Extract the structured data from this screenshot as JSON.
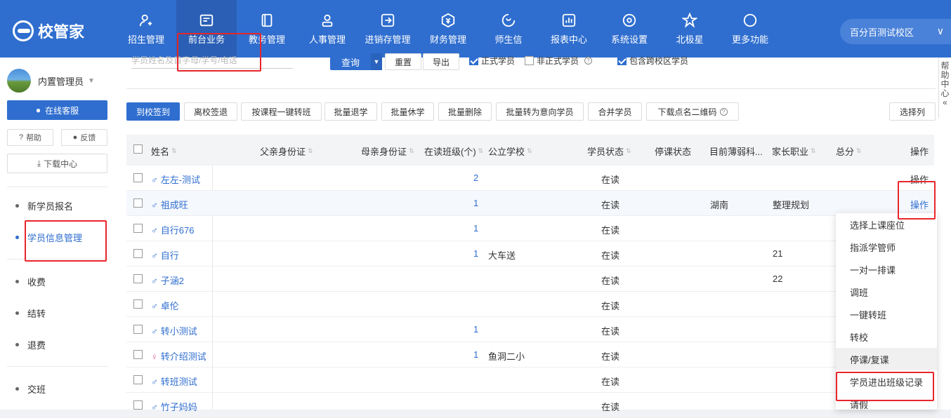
{
  "brand": {
    "name": "校管家"
  },
  "nav": [
    {
      "label": "招生管理",
      "icon": "user-plus-icon"
    },
    {
      "label": "前台业务",
      "icon": "reception-icon"
    },
    {
      "label": "教务管理",
      "icon": "book-icon"
    },
    {
      "label": "人事管理",
      "icon": "person-icon"
    },
    {
      "label": "进销存管理",
      "icon": "inventory-icon"
    },
    {
      "label": "财务管理",
      "icon": "finance-icon"
    },
    {
      "label": "师生信",
      "icon": "message-icon"
    },
    {
      "label": "报表中心",
      "icon": "chart-icon"
    },
    {
      "label": "系统设置",
      "icon": "settings-icon"
    },
    {
      "label": "北极星",
      "icon": "star-icon"
    },
    {
      "label": "更多功能",
      "icon": "more-icon"
    }
  ],
  "campus": "百分百测试校区",
  "sidebar": {
    "user": "内置管理员",
    "service": "在线客服",
    "help": "帮助",
    "feedback": "反馈",
    "download": "下载中心",
    "items": [
      "新学员报名",
      "学员信息管理",
      "收费",
      "结转",
      "退费",
      "交班"
    ]
  },
  "search": {
    "placeholder": "学员姓名及首字母/学号/电话",
    "query": "查询",
    "reset": "重置",
    "export": "导出",
    "formal": "正式学员",
    "informal": "非正式学员",
    "cross": "包含跨校区学员"
  },
  "toolbar": [
    "到校签到",
    "离校签退",
    "按课程一键转班",
    "批量退学",
    "批量休学",
    "批量删除",
    "批量转为意向学员",
    "合并学员",
    "下载点名二维码"
  ],
  "select_col": "选择列",
  "columns": [
    "姓名",
    "父亲身份证",
    "母亲身份证",
    "在读班级(个)",
    "公立学校",
    "学员状态",
    "停课状态",
    "目前薄弱科...",
    "家长职业",
    "总分",
    "操作"
  ],
  "rows": [
    {
      "name": "左左-测试",
      "gender": "male",
      "classes": "2",
      "school": "",
      "status": "在读",
      "weak": "",
      "job": "",
      "op": "操作"
    },
    {
      "name": "祖成旺",
      "gender": "male",
      "classes": "1",
      "school": "",
      "status": "在读",
      "weak": "湖南",
      "job": "整理规划",
      "op": "操作"
    },
    {
      "name": "自行676",
      "gender": "male",
      "classes": "1",
      "school": "",
      "status": "在读",
      "weak": "",
      "job": "",
      "op": ""
    },
    {
      "name": "自行",
      "gender": "male",
      "classes": "1",
      "school": "大车送",
      "status": "在读",
      "weak": "",
      "job": "21",
      "op": ""
    },
    {
      "name": "子涵2",
      "gender": "male",
      "classes": "",
      "school": "",
      "status": "在读",
      "weak": "",
      "job": "22",
      "op": ""
    },
    {
      "name": "卓伦",
      "gender": "male",
      "classes": "",
      "school": "",
      "status": "在读",
      "weak": "",
      "job": "",
      "op": ""
    },
    {
      "name": "转小测试",
      "gender": "male",
      "classes": "1",
      "school": "",
      "status": "在读",
      "weak": "",
      "job": "",
      "op": ""
    },
    {
      "name": "转介绍测试",
      "gender": "female",
      "classes": "1",
      "school": "鱼洞二小",
      "status": "在读",
      "weak": "",
      "job": "",
      "op": ""
    },
    {
      "name": "转班测试",
      "gender": "male",
      "classes": "",
      "school": "",
      "status": "在读",
      "weak": "",
      "job": "",
      "op": ""
    },
    {
      "name": "竹子妈妈",
      "gender": "male",
      "classes": "",
      "school": "",
      "status": "在读",
      "weak": "",
      "job": "",
      "op": ""
    }
  ],
  "dropdown": [
    "选择上课座位",
    "指派学管师",
    "一对一排课",
    "调班",
    "一键转班",
    "转校",
    "停课/复课",
    "学员进出班级记录",
    "请假"
  ],
  "help_tab": "帮助中心",
  "colors": {
    "primary": "#2f6ecf",
    "highlight": "#e8262b"
  }
}
